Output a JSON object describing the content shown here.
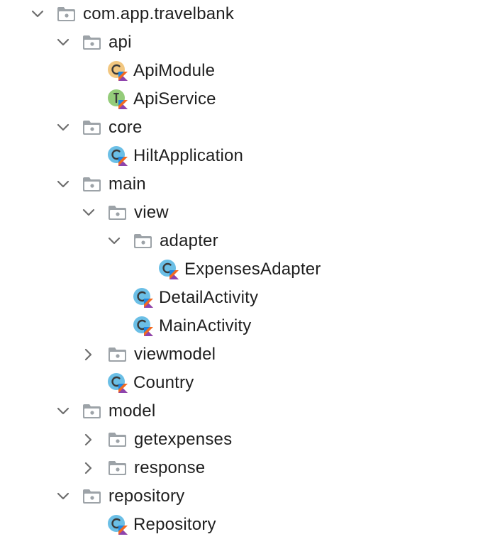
{
  "tree": {
    "root": {
      "label": "com.app.travelbank",
      "expanded": true
    },
    "api": {
      "label": "api",
      "expanded": true,
      "api_module": {
        "label": "ApiModule",
        "kind": "kotlin-class-object",
        "icon_color": "#f2c780"
      },
      "api_service": {
        "label": "ApiService",
        "kind": "kotlin-interface",
        "icon_color": "#94cc7a"
      }
    },
    "core": {
      "label": "core",
      "expanded": true,
      "hilt_application": {
        "label": "HiltApplication",
        "kind": "kotlin-class",
        "icon_color": "#6bbfe6"
      }
    },
    "main": {
      "label": "main",
      "expanded": true,
      "view": {
        "label": "view",
        "expanded": true,
        "adapter": {
          "label": "adapter",
          "expanded": true,
          "expenses_adapter": {
            "label": "ExpensesAdapter",
            "kind": "kotlin-class",
            "icon_color": "#6bbfe6"
          }
        },
        "detail_activity": {
          "label": "DetailActivity",
          "kind": "kotlin-class",
          "icon_color": "#6bbfe6"
        },
        "main_activity": {
          "label": "MainActivity",
          "kind": "kotlin-class",
          "icon_color": "#6bbfe6"
        }
      },
      "viewmodel": {
        "label": "viewmodel",
        "expanded": false
      },
      "country": {
        "label": "Country",
        "kind": "kotlin-class",
        "icon_color": "#6bbfe6"
      }
    },
    "model": {
      "label": "model",
      "expanded": true,
      "getexpenses": {
        "label": "getexpenses",
        "expanded": false
      },
      "response": {
        "label": "response",
        "expanded": false
      }
    },
    "repository": {
      "label": "repository",
      "expanded": true,
      "repository_class": {
        "label": "Repository",
        "kind": "kotlin-class",
        "icon_color": "#6bbfe6"
      }
    }
  },
  "colors": {
    "folder": "#9da3a8",
    "chevron": "#6e6e6e",
    "text": "#1f1f1f",
    "kotlin_orange": "#f26a21",
    "kotlin_blue": "#1e88e5"
  },
  "icons": {
    "expanded": "chevron-down-icon",
    "collapsed": "chevron-right-icon",
    "folder": "package-folder-icon"
  }
}
